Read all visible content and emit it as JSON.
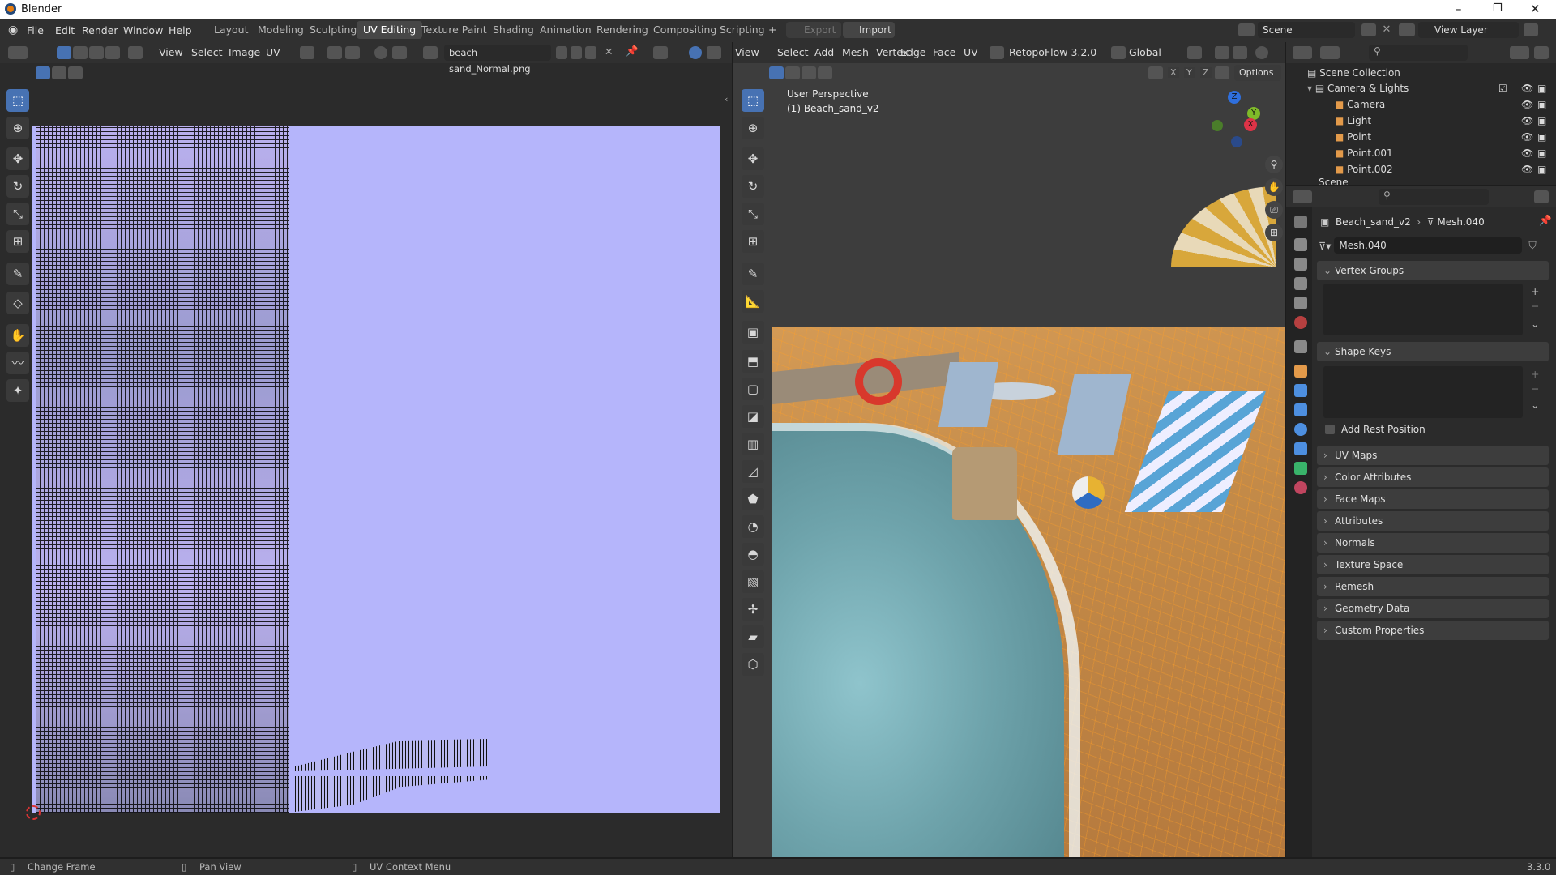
{
  "window": {
    "title": "Blender"
  },
  "menus": [
    "File",
    "Edit",
    "Render",
    "Window",
    "Help"
  ],
  "workspaces": [
    {
      "label": "Layout",
      "active": false
    },
    {
      "label": "Modeling",
      "active": false
    },
    {
      "label": "Sculpting",
      "active": false
    },
    {
      "label": "UV Editing",
      "active": true
    },
    {
      "label": "Texture Paint",
      "active": false
    },
    {
      "label": "Shading",
      "active": false
    },
    {
      "label": "Animation",
      "active": false
    },
    {
      "label": "Rendering",
      "active": false
    },
    {
      "label": "Compositing",
      "active": false
    },
    {
      "label": "Scripting",
      "active": false
    }
  ],
  "topbar": {
    "add_workspace": "+",
    "export_label": "Export",
    "import_label": "Import",
    "scene_label": "Scene",
    "view_layer_label": "View Layer"
  },
  "uv_editor": {
    "menus": [
      "View",
      "Select",
      "Image",
      "UV"
    ],
    "image_name": "beach sand_Normal.png",
    "colors": {
      "bg_blue": "#b5b5fb",
      "canvas": "#2b2b2b"
    }
  },
  "viewport": {
    "menus": [
      "View",
      "Select",
      "Add",
      "Mesh",
      "Vertex",
      "Edge",
      "Face",
      "UV"
    ],
    "addon_label": "RetopoFlow 3.2.0",
    "orientation": "Global",
    "axes": [
      "X",
      "Y",
      "Z"
    ],
    "options_label": "Options",
    "overlay_line1": "User Perspective",
    "overlay_line2": "(1) Beach_sand_v2",
    "gizmo": {
      "z": "Z",
      "y": "Y",
      "x": "X"
    }
  },
  "outliner": {
    "root": "Scene Collection",
    "collection": "Camera & Lights",
    "items": [
      {
        "label": "Camera",
        "icon": "camera-icon"
      },
      {
        "label": "Light",
        "icon": "light-icon"
      },
      {
        "label": "Point",
        "icon": "point-light-icon"
      },
      {
        "label": "Point.001",
        "icon": "point-light-icon"
      },
      {
        "label": "Point.002",
        "icon": "point-light-icon"
      }
    ],
    "partial": "Scene"
  },
  "properties": {
    "object": "Beach_sand_v2",
    "mesh": "Mesh.040",
    "datablock": "Mesh.040",
    "vertex_groups": "Vertex Groups",
    "shape_keys": "Shape Keys",
    "add_rest_position": "Add Rest Position",
    "panels": [
      "UV Maps",
      "Color Attributes",
      "Face Maps",
      "Attributes",
      "Normals",
      "Texture Space",
      "Remesh",
      "Geometry Data",
      "Custom Properties"
    ]
  },
  "status": {
    "item1": "Change Frame",
    "item2": "Pan View",
    "item3": "UV Context Menu",
    "version": "3.3.0"
  }
}
